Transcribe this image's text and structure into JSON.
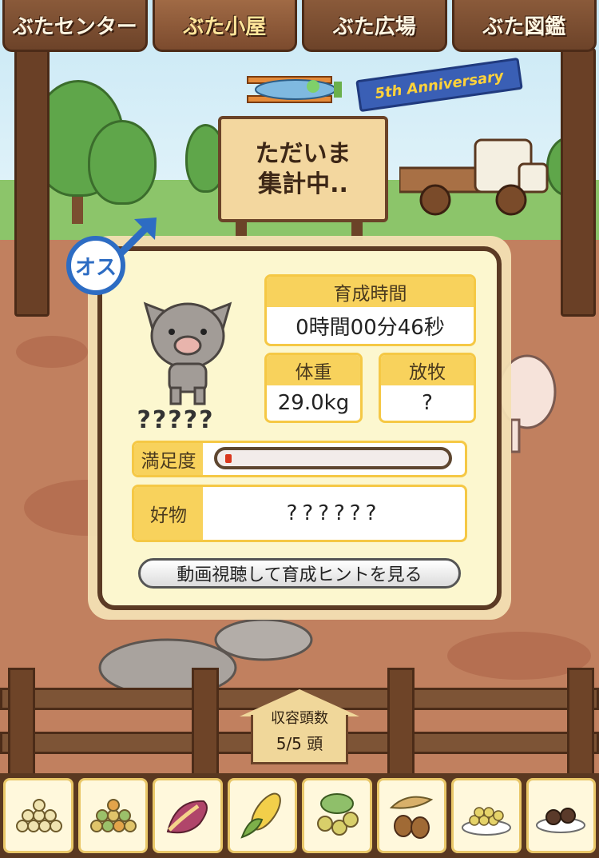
{
  "nav": {
    "tabs": [
      {
        "label": "ぶたセンター",
        "active": false
      },
      {
        "label": "ぶた小屋",
        "active": true
      },
      {
        "label": "ぶた広場",
        "active": false
      },
      {
        "label": "ぶた図鑑",
        "active": false
      }
    ]
  },
  "scene": {
    "sign_line1": "ただいま",
    "sign_line2": "集計中..",
    "banner": "5th Anniversary"
  },
  "pig_card": {
    "gender_label": "オス",
    "name": "?????",
    "growth_time_label": "育成時間",
    "growth_time_value": "0時間00分46秒",
    "weight_label": "体重",
    "weight_value": "29.0kg",
    "grazing_label": "放牧",
    "grazing_value": "?",
    "satisfaction_label": "満足度",
    "satisfaction_level": 0.03,
    "favorite_label": "好物",
    "favorite_value": "??????",
    "hint_button": "動画視聴して育成ヒントを見る"
  },
  "capacity": {
    "title": "収容頭数",
    "value": "5/5 頭"
  },
  "food_items": [
    {
      "icon": "white-beans-icon"
    },
    {
      "icon": "mixed-beans-icon"
    },
    {
      "icon": "sweet-potato-icon"
    },
    {
      "icon": "corn-icon"
    },
    {
      "icon": "herbs-icon"
    },
    {
      "icon": "acorn-icon"
    },
    {
      "icon": "rice-bowl-icon"
    },
    {
      "icon": "truffle-plate-icon"
    }
  ],
  "colors": {
    "accent_yellow": "#f8d25c",
    "panel_bg": "#fcf7cf",
    "male_blue": "#2d6cc3",
    "bar_red": "#d9381e"
  }
}
